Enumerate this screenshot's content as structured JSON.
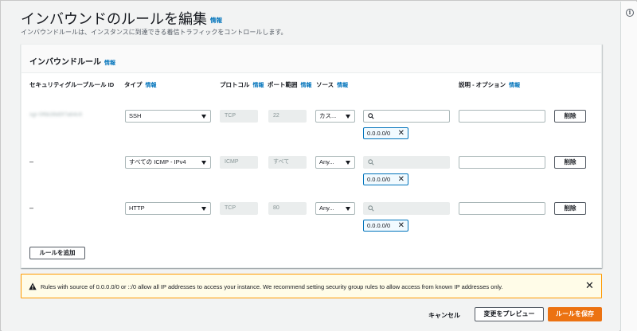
{
  "page": {
    "title": "インバウンドのルールを編集",
    "title_info": "情報",
    "description": "インバウンドルールは、インスタンスに到達できる着信トラフィックをコントロールします。"
  },
  "panel": {
    "title": "インバウンドルール",
    "title_info": "情報",
    "columns": {
      "rule_id": "セキュリティグループルール ID",
      "type": "タイプ",
      "protocol": "プロトコル",
      "port_range": "ポート範囲",
      "source": "ソース",
      "description": "説明 - オプション"
    },
    "column_info": "情報",
    "rows": [
      {
        "rule_id": "sgr-0f6b38d0f7a64c6",
        "type": "SSH",
        "protocol": "TCP",
        "port_range": "22",
        "source": "カス...",
        "cidr": "0.0.0.0/0",
        "delete_label": "削除"
      },
      {
        "rule_id": "–",
        "type": "すべての ICMP - IPv4",
        "protocol": "ICMP",
        "port_range": "すべて",
        "source": "Any...",
        "cidr": "0.0.0.0/0",
        "delete_label": "削除"
      },
      {
        "rule_id": "–",
        "type": "HTTP",
        "protocol": "TCP",
        "port_range": "80",
        "source": "Any...",
        "cidr": "0.0.0.0/0",
        "delete_label": "削除"
      }
    ],
    "add_rule_label": "ルールを追加"
  },
  "warning": {
    "text": "Rules with source of 0.0.0.0/0 or ::/0 allow all IP addresses to access your instance. We recommend setting security group rules to allow access from known IP addresses only."
  },
  "footer": {
    "cancel_label": "キャンセル",
    "preview_label": "変更をプレビュー",
    "save_label": "ルールを保存"
  },
  "colors": {
    "accent": "#ec7211",
    "link": "#0073bb",
    "warning_border": "#ff9900",
    "token_border": "#0073bb"
  }
}
